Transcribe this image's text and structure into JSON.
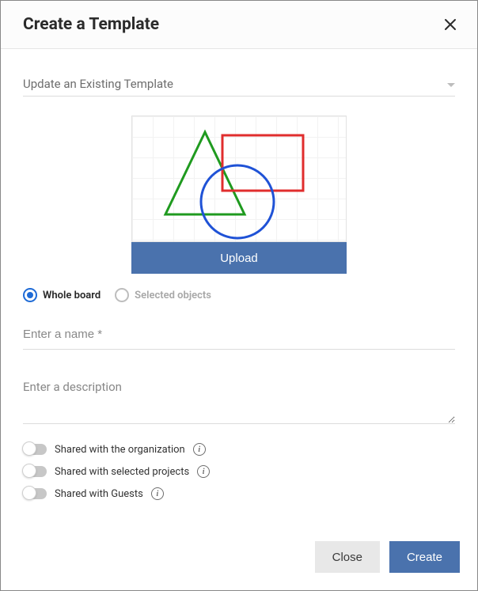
{
  "header": {
    "title": "Create a Template"
  },
  "dropdown": {
    "label": "Update an Existing Template"
  },
  "upload": {
    "button": "Upload"
  },
  "scope": {
    "whole_board": "Whole board",
    "selected_objects": "Selected objects"
  },
  "fields": {
    "name_placeholder": "Enter a name *",
    "desc_placeholder": "Enter a description"
  },
  "toggles": {
    "org": "Shared with the organization",
    "projects": "Shared with selected projects",
    "guests": "Shared with Guests"
  },
  "footer": {
    "close": "Close",
    "create": "Create"
  }
}
